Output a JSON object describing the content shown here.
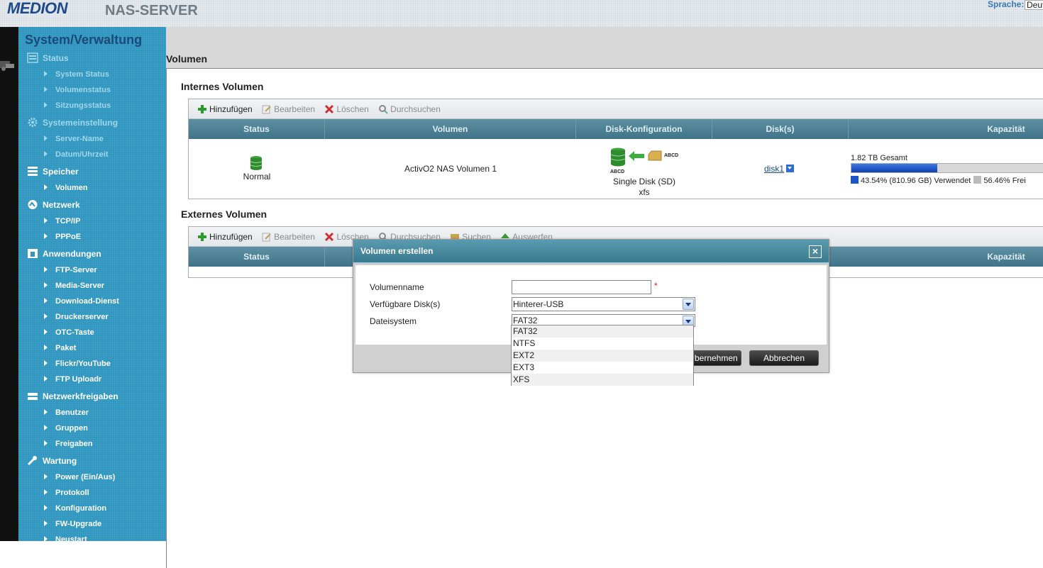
{
  "header": {
    "logo": "MEDION",
    "product": "NAS-SERVER",
    "language_label": "Sprache:",
    "language_value": "Deutsch"
  },
  "sidebar": {
    "title": "System/Verwaltung",
    "sections": [
      {
        "label": "Status",
        "icon": "status-icon",
        "items": [
          "System Status",
          "Volumenstatus",
          "Sitzungsstatus"
        ]
      },
      {
        "label": "Systemeinstellung",
        "icon": "gear-icon",
        "items": [
          "Server-Name",
          "Datum/Uhrzeit"
        ]
      },
      {
        "label": "Speicher",
        "icon": "storage-icon",
        "items": [
          "Volumen"
        ]
      },
      {
        "label": "Netzwerk",
        "icon": "network-icon",
        "items": [
          "TCP/IP",
          "PPPoE"
        ]
      },
      {
        "label": "Anwendungen",
        "icon": "applications-icon",
        "items": [
          "FTP-Server",
          "Media-Server",
          "Download-Dienst",
          "Druckerserver",
          "OTC-Taste",
          "Paket",
          "Flickr/YouTube",
          "FTP Uploadr"
        ]
      },
      {
        "label": "Netzwerkfreigaben",
        "icon": "shares-icon",
        "items": [
          "Benutzer",
          "Gruppen",
          "Freigaben"
        ]
      },
      {
        "label": "Wartung",
        "icon": "maintenance-icon",
        "items": [
          "Power (Ein/Aus)",
          "Protokoll",
          "Konfiguration",
          "FW-Upgrade",
          "Neustart"
        ]
      }
    ]
  },
  "main": {
    "title": "Volumen",
    "internal": {
      "title": "Internes Volumen",
      "toolbar": [
        "Hinzufügen",
        "Bearbeiten",
        "Löschen",
        "Durchsuchen"
      ],
      "columns": [
        "Status",
        "Volumen",
        "Disk-Konfiguration",
        "Disk(s)",
        "Kapazität"
      ],
      "row": {
        "status": "Normal",
        "volume": "ActivO2 NAS Volumen 1",
        "disk_label_a": "ABCD",
        "disk_label_b": "ABCD",
        "config": "Single Disk (SD)",
        "fs": "xfs",
        "disk": "disk1",
        "capacity_total": "1.82 TB Gesamt",
        "used_fraction": 0.4354,
        "used_text": "43.54% (810.96 GB) Verwendet",
        "free_text": "56.46% Frei"
      }
    },
    "external": {
      "title": "Externes Volumen",
      "toolbar": [
        "Hinzufügen",
        "Bearbeiten",
        "Löschen",
        "Durchsuchen",
        "Suchen",
        "Auswerfen"
      ],
      "columns": [
        "Status",
        "Kapazität"
      ]
    }
  },
  "dialog": {
    "title": "Volumen erstellen",
    "close": "×",
    "fields": {
      "name_label": "Volumenname",
      "name_value": "",
      "required_mark": "*",
      "disk_label": "Verfügbare Disk(s)",
      "disk_value": "Hinterer-USB",
      "fs_label": "Dateisystem",
      "fs_value": "FAT32"
    },
    "fs_options": [
      "FAT32",
      "NTFS",
      "EXT2",
      "EXT3",
      "XFS"
    ],
    "buttons": {
      "ok": "Übernehmen",
      "cancel": "Abbrechen"
    }
  },
  "colors": {
    "sidebar": "#2f96c0",
    "table_header": "#4a7d91",
    "dialog_header": "#4a8aa0",
    "bar_used": "#1a55c8",
    "bar_free": "#d8d8d8"
  }
}
